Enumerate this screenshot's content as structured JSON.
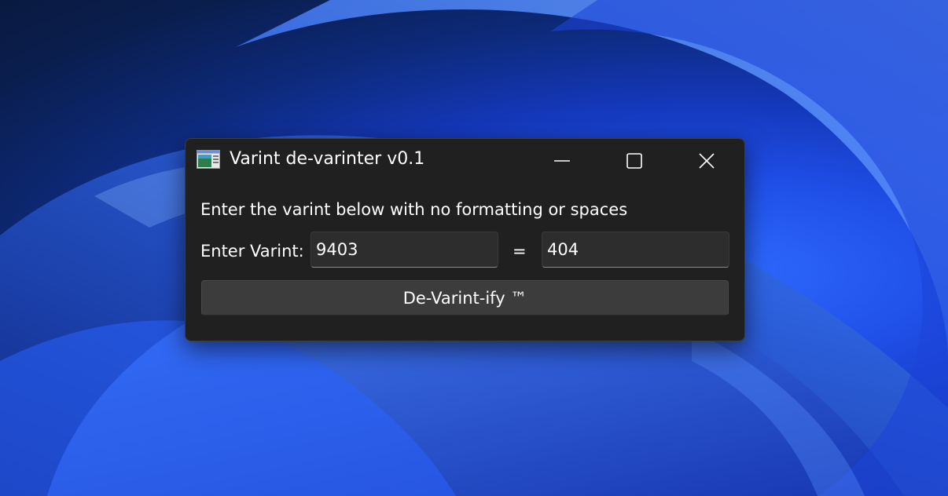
{
  "window": {
    "title": "Varint de-varinter v0.1",
    "icon": "app-window-icon"
  },
  "caption_buttons": {
    "minimize_icon": "minimize-icon",
    "maximize_icon": "maximize-icon",
    "close_icon": "close-icon"
  },
  "form": {
    "instructions": "Enter the varint below with no formatting or spaces",
    "varint_label": "Enter Varint:",
    "varint_value": "9403",
    "equals_sign": "=",
    "result_value": "404",
    "action_label": "De-Varint-ify ™"
  },
  "colors": {
    "window_bg": "#202020",
    "field_bg": "#2d2d2d",
    "button_bg": "#3c3c3c",
    "text": "#ffffff",
    "wallpaper_accent": "#1f4ee6"
  }
}
